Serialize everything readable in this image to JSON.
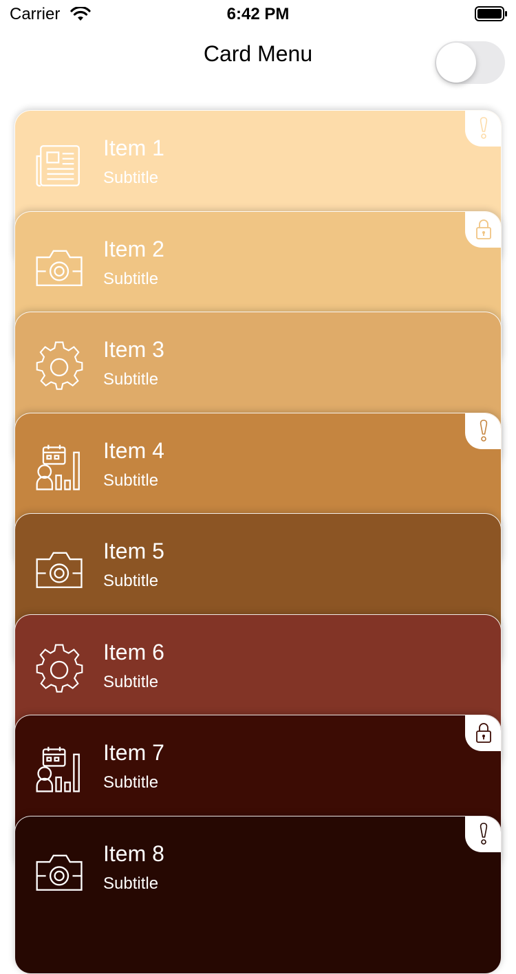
{
  "status_bar": {
    "carrier": "Carrier",
    "time": "6:42 PM"
  },
  "header": {
    "title": "Card Menu",
    "toggle_on": false
  },
  "cards": [
    {
      "title": "Item 1",
      "subtitle": "Subtitle",
      "icon": "newspaper-icon",
      "badge": "exclamation-icon",
      "color": "#fddcaa"
    },
    {
      "title": "Item 2",
      "subtitle": "Subtitle",
      "icon": "camera-icon",
      "badge": "lock-icon",
      "color": "#f0c584"
    },
    {
      "title": "Item 3",
      "subtitle": "Subtitle",
      "icon": "gear-icon",
      "badge": "",
      "color": "#dfab69"
    },
    {
      "title": "Item 4",
      "subtitle": "Subtitle",
      "icon": "calendar-chart-icon",
      "badge": "exclamation-icon",
      "color": "#c58540"
    },
    {
      "title": "Item 5",
      "subtitle": "Subtitle",
      "icon": "camera-icon",
      "badge": "",
      "color": "#8c5524"
    },
    {
      "title": "Item 6",
      "subtitle": "Subtitle",
      "icon": "gear-icon",
      "badge": "",
      "color": "#823426"
    },
    {
      "title": "Item 7",
      "subtitle": "Subtitle",
      "icon": "calendar-chart-icon",
      "badge": "lock-icon",
      "color": "#3c0c04"
    },
    {
      "title": "Item 8",
      "subtitle": "Subtitle",
      "icon": "camera-icon",
      "badge": "exclamation-icon",
      "color": "#260802"
    }
  ]
}
